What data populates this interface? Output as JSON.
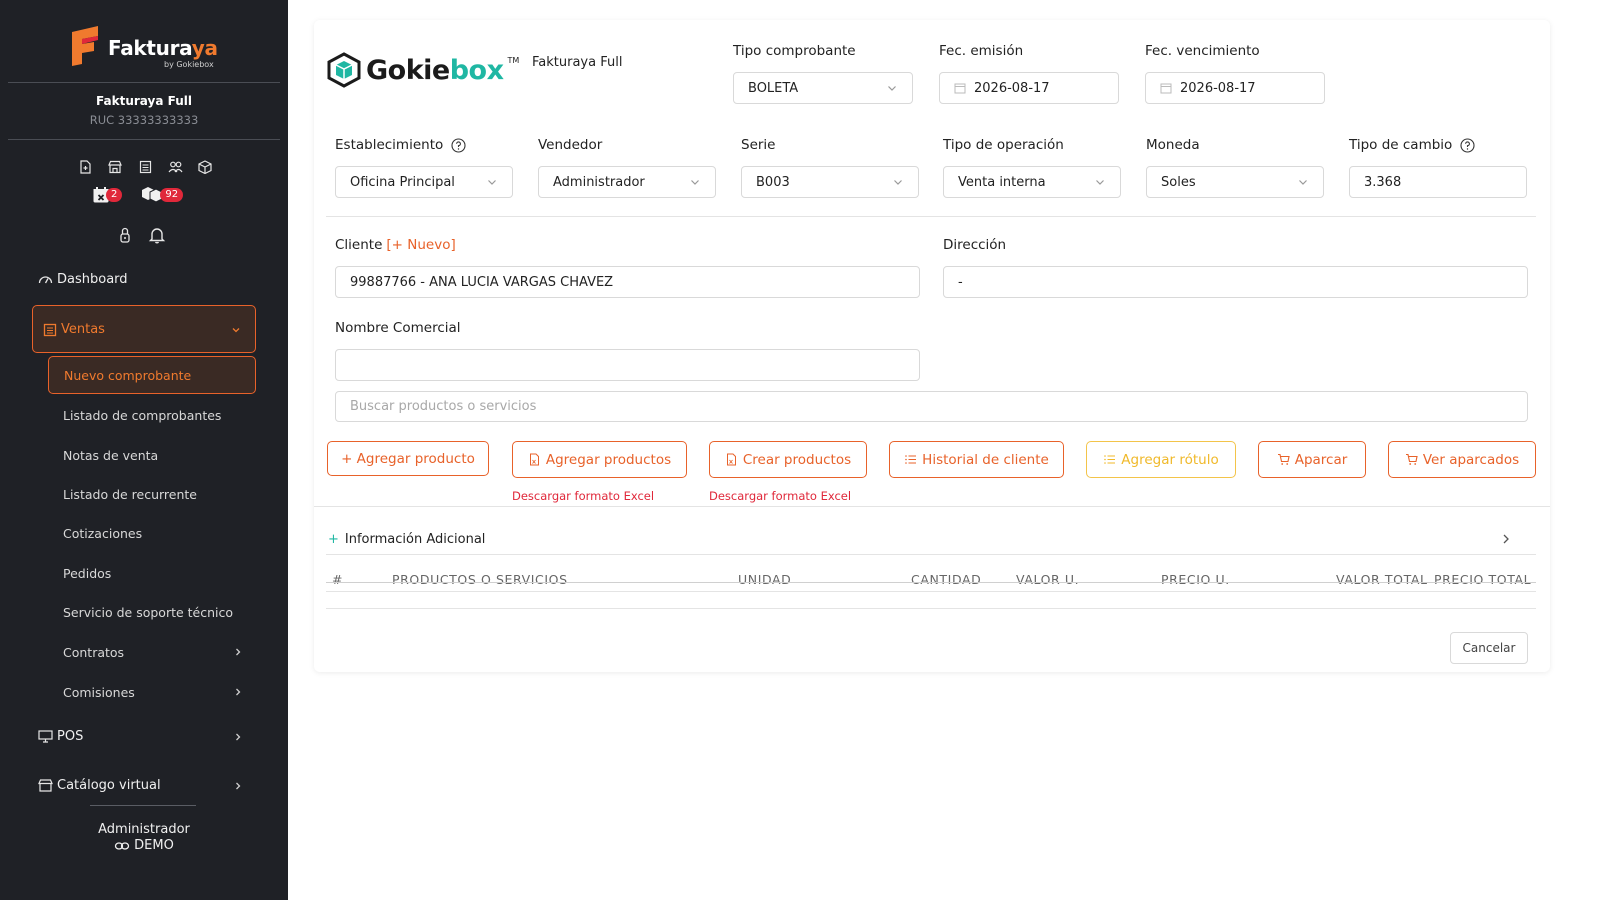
{
  "colors": {
    "accent": "#e8622a",
    "sidebar_bg": "#1f2126",
    "teal": "#1fb7a3",
    "warning": "#f0b92a",
    "badge": "#e0283a"
  },
  "sidebar": {
    "brand": "Fakturaya",
    "brand_main": "Fakturaya",
    "brand_sub": "by Gokiebox",
    "company_name": "Fakturaya Full",
    "ruc": "RUC 33333333333",
    "quick_icons": [
      "new-document-icon",
      "store-icon",
      "list-icon",
      "users-icon",
      "box-icon"
    ],
    "badge_calendar": "2",
    "badge_boxes": "92",
    "menu": {
      "dashboard": "Dashboard",
      "ventas": "Ventas",
      "pos": "POS",
      "catalogo": "Catálogo virtual"
    },
    "ventas_sub": [
      "Nuevo comprobante",
      "Listado de comprobantes",
      "Notas de venta",
      "Listado de recurrente",
      "Cotizaciones",
      "Pedidos",
      "Servicio de soporte técnico",
      "Contratos",
      "Comisiones"
    ],
    "user_name": "Administrador",
    "user_env": "DEMO"
  },
  "header": {
    "company_logo": "Gokiebox",
    "company_name": "Fakturaya Full",
    "tipo_comprobante": {
      "label": "Tipo comprobante",
      "value": "BOLETA"
    },
    "fec_emision": {
      "label": "Fec. emisión",
      "value": "2026-08-17"
    },
    "fec_vencimiento": {
      "label": "Fec. vencimiento",
      "value": "2026-08-17"
    }
  },
  "form": {
    "establecimiento": {
      "label": "Establecimiento",
      "value": "Oficina Principal"
    },
    "vendedor": {
      "label": "Vendedor",
      "value": "Administrador"
    },
    "serie": {
      "label": "Serie",
      "value": "B003"
    },
    "tipo_operacion": {
      "label": "Tipo de operación",
      "value": "Venta interna"
    },
    "moneda": {
      "label": "Moneda",
      "value": "Soles"
    },
    "tipo_cambio": {
      "label": "Tipo de cambio",
      "value": "3.368"
    },
    "cliente": {
      "label": "Cliente",
      "new_link": "[+ Nuevo]",
      "value": "99887766 - ANA LUCIA VARGAS CHAVEZ"
    },
    "direccion": {
      "label": "Dirección",
      "value": "-"
    },
    "nombre_comercial": {
      "label": "Nombre Comercial",
      "value": ""
    },
    "buscar": {
      "placeholder": "Buscar productos o servicios"
    }
  },
  "actions": {
    "agregar_producto": "+ Agregar producto",
    "agregar_productos": "Agregar productos",
    "crear_productos": "Crear productos",
    "historial_cliente": "Historial de cliente",
    "agregar_rotulo": "Agregar rótulo",
    "aparcar": "Aparcar",
    "ver_aparcados": "Ver aparcados",
    "descargar_excel_1": "Descargar formato Excel",
    "descargar_excel_2": "Descargar formato Excel"
  },
  "info_adicional": {
    "plus": "+",
    "label": "Información Adicional"
  },
  "table": {
    "headers": [
      "#",
      "PRODUCTOS O SERVICIOS",
      "UNIDAD",
      "CANTIDAD",
      "VALOR U.",
      "PRECIO U.",
      "VALOR TOTAL",
      "PRECIO TOTAL"
    ]
  },
  "footer": {
    "cancel": "Cancelar"
  }
}
